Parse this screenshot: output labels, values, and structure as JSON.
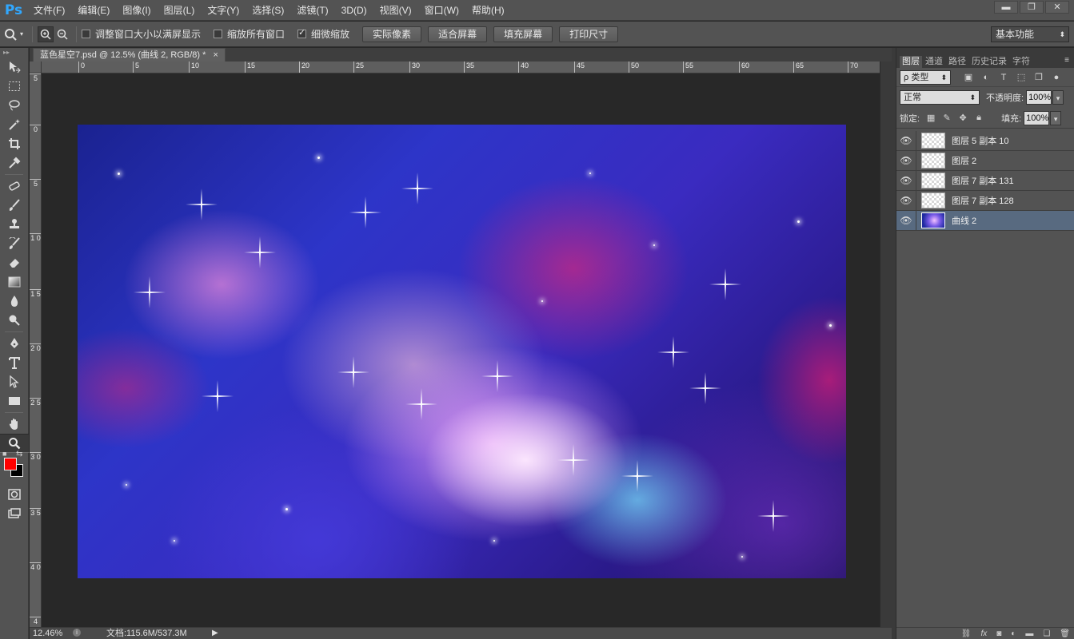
{
  "app": {
    "logo": "Ps"
  },
  "menu": [
    "文件(F)",
    "编辑(E)",
    "图像(I)",
    "图层(L)",
    "文字(Y)",
    "选择(S)",
    "滤镜(T)",
    "3D(D)",
    "视图(V)",
    "窗口(W)",
    "帮助(H)"
  ],
  "window_controls": {
    "minimize": "▬",
    "restore": "❐",
    "close": "✕"
  },
  "options": {
    "resize_windows_label": "调整窗口大小以满屏显示",
    "resize_windows_checked": false,
    "zoom_all_label": "缩放所有窗口",
    "zoom_all_checked": false,
    "scrubby_zoom_label": "细微缩放",
    "scrubby_zoom_checked": true,
    "buttons": [
      "实际像素",
      "适合屏幕",
      "填充屏幕",
      "打印尺寸"
    ],
    "workspace": "基本功能"
  },
  "document": {
    "tab_title": "蓝色星空7.psd @ 12.5% (曲线 2, RGB/8) *",
    "tab_close": "×"
  },
  "ruler_h": [
    "0",
    "5",
    "10",
    "15",
    "20",
    "25",
    "30",
    "35",
    "40",
    "45",
    "50",
    "55",
    "60",
    "65",
    "70"
  ],
  "ruler_v": [
    "5",
    "0",
    "5",
    "1 0",
    "1 5",
    "2 0",
    "2 5",
    "3 0",
    "3 5",
    "4 0",
    "4"
  ],
  "status": {
    "zoom": "12.46%",
    "doc_size": "文档:115.6M/537.3M"
  },
  "panels": {
    "tabs": [
      "图层",
      "通道",
      "路径",
      "历史记录",
      "字符"
    ],
    "active_tab": "图层",
    "filter_kind": "ρ 类型",
    "blend_mode": "正常",
    "opacity_label": "不透明度:",
    "opacity_value": "100%",
    "lock_label": "锁定:",
    "fill_label": "填充:",
    "fill_value": "100%"
  },
  "layers": [
    {
      "name": "图层 5 副本 10",
      "visible": true,
      "selected": false,
      "thumb": "transparent"
    },
    {
      "name": "图层 2",
      "visible": true,
      "selected": false,
      "thumb": "transparent"
    },
    {
      "name": "图层 7 副本 131",
      "visible": true,
      "selected": false,
      "thumb": "transparent"
    },
    {
      "name": "图层 7 副本 128",
      "visible": true,
      "selected": false,
      "thumb": "transparent"
    },
    {
      "name": "曲线 2",
      "visible": true,
      "selected": true,
      "thumb": "image"
    }
  ],
  "colors": {
    "foreground": "#ff0000",
    "background": "#000000",
    "ps_blue": "#31a8ff",
    "selected_layer": "#586a80"
  }
}
